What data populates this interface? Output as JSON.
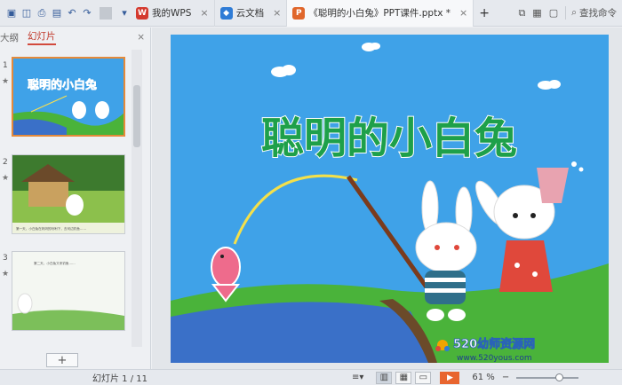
{
  "topbar": {
    "tabs": [
      {
        "icon": "wps-icon",
        "label": "我的WPS",
        "close": "×",
        "color": "#d43a2f"
      },
      {
        "icon": "cloud-doc-icon",
        "label": "云文档",
        "close": "×",
        "color": "#2f7cd6"
      },
      {
        "icon": "ppt-file-icon",
        "label": "《聪明的小白兔》PPT课件.pptx *",
        "close": "×",
        "color": "#e0662b"
      }
    ],
    "new_tab": "+",
    "search_label": "查找命令"
  },
  "left_panel": {
    "outline_tab": "大纲",
    "slides_tab": "幻灯片",
    "close": "×",
    "thumbnails": [
      {
        "number": "1",
        "star": "★",
        "title": "聪明的小白兔"
      },
      {
        "number": "2",
        "star": "★",
        "caption": "第一天，小白兔在妈妈的吩咐下，去河边钓鱼……"
      },
      {
        "number": "3",
        "star": "★",
        "caption": "第二天，小白兔又来钓鱼……"
      }
    ],
    "add_label": "+"
  },
  "slide": {
    "title": "聪明的小白兔",
    "logo_text": "520幼师资源网",
    "logo_url": "www.520yous.com"
  },
  "status": {
    "slide_count": "幻灯片 1 / 11",
    "zoom": "61 %",
    "zoom_fraction": 0.61
  },
  "colors": {
    "sky": "#3fa2e8",
    "grass": "#4ab33a",
    "water": "#3a70c8",
    "title_green": "#1ea04a",
    "accent_orange": "#e58a3a"
  }
}
